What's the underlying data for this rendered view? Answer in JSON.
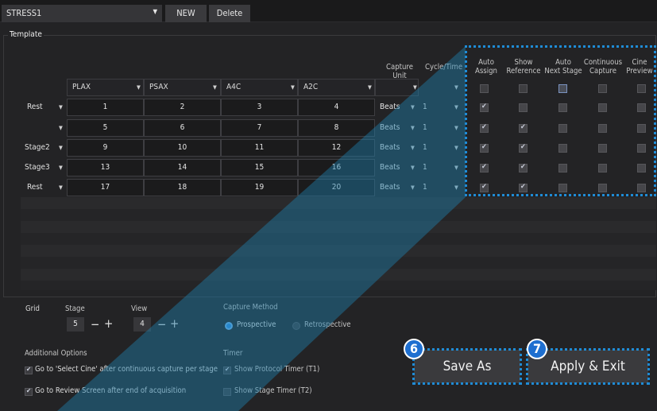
{
  "toolbar": {
    "preset_value": "STRESS1",
    "new_label": "NEW",
    "delete_label": "Delete"
  },
  "template": {
    "title": "Template",
    "view_headers": [
      "PLAX",
      "PSAX",
      "A4C",
      "A2C",
      ""
    ],
    "capture_unit_header": "Capture Unit",
    "cycle_time_header": "Cycle/Time",
    "option_headers": [
      {
        "line1": "Auto",
        "line2": "Assign"
      },
      {
        "line1": "Show",
        "line2": "Reference"
      },
      {
        "line1": "Auto",
        "line2": "Next Stage"
      },
      {
        "line1": "Continuous",
        "line2": "Capture"
      },
      {
        "line1": "Cine",
        "line2": "Preview"
      }
    ],
    "rows": [
      {
        "label": "Rest",
        "cells": [
          "1",
          "2",
          "3",
          "4"
        ],
        "unit": "Beats",
        "cycle": "1",
        "checks": [
          true,
          false,
          false,
          false,
          false
        ]
      },
      {
        "label": "",
        "cells": [
          "5",
          "6",
          "7",
          "8"
        ],
        "unit": "Beats",
        "cycle": "1",
        "checks": [
          true,
          true,
          false,
          false,
          false
        ]
      },
      {
        "label": "Stage2",
        "cells": [
          "9",
          "10",
          "11",
          "12"
        ],
        "unit": "Beats",
        "cycle": "1",
        "checks": [
          true,
          true,
          false,
          false,
          false
        ]
      },
      {
        "label": "Stage3",
        "cells": [
          "13",
          "14",
          "15",
          "16"
        ],
        "unit": "Beats",
        "cycle": "1",
        "checks": [
          true,
          true,
          false,
          false,
          false
        ]
      },
      {
        "label": "Rest",
        "cells": [
          "17",
          "18",
          "19",
          "20"
        ],
        "unit": "Beats",
        "cycle": "1",
        "checks": [
          true,
          true,
          false,
          false,
          false
        ]
      }
    ]
  },
  "grid": {
    "label": "Grid",
    "stage_label": "Stage",
    "stage_value": "5",
    "view_label": "View",
    "view_value": "4",
    "minus": "−",
    "plus": "+"
  },
  "capture_method": {
    "label": "Capture Method",
    "prospective": "Prospective",
    "retrospective": "Retrospective",
    "selected": "Prospective"
  },
  "additional_options": {
    "label": "Additional Options",
    "items": [
      {
        "text": "Go to 'Select Cine' after continuous capture per stage",
        "checked": true
      },
      {
        "text": "Go to Review Screen after end of acquisition",
        "checked": true
      }
    ]
  },
  "timer": {
    "label": "Timer",
    "items": [
      {
        "text": "Show Protocol Timer (T1)",
        "checked": true
      },
      {
        "text": "Show Stage Timer (T2)",
        "checked": false
      }
    ]
  },
  "actions": {
    "save_as": "Save As",
    "apply_exit": "Apply & Exit",
    "badge_save": "6",
    "badge_apply": "7"
  },
  "colors": {
    "background": "#232325",
    "callout_highlight": "#1f8cd6",
    "callout_fill": "#1e6fa0",
    "badge": "#1e6fd0",
    "radio_selected": "#2e8fe8"
  }
}
